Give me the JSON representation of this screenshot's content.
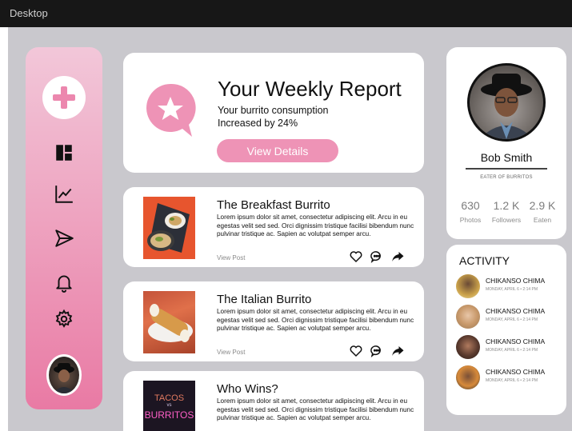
{
  "window": {
    "title": "Desktop"
  },
  "sidebar": {
    "items": [
      {
        "icon": "plus-icon"
      },
      {
        "icon": "dashboard-icon"
      },
      {
        "icon": "chart-icon"
      },
      {
        "icon": "send-icon"
      },
      {
        "icon": "bell-icon"
      },
      {
        "icon": "gear-icon"
      }
    ],
    "avatar": "user-avatar"
  },
  "report": {
    "title": "Your Weekly Report",
    "line1": "Your burrito consumption",
    "line2": "Increased by 24%",
    "button": "View Details"
  },
  "posts": [
    {
      "title": "The Breakfast Burrito",
      "body": "Lorem ipsum dolor sit amet, consectetur adipiscing elit. Arcu in eu egestas velit sed sed. Orci dignissim tristique facilisi bibendum nunc pulvinar tristique ac. Sapien ac volutpat semper arcu.",
      "link": "View Post"
    },
    {
      "title": "The Italian Burrito",
      "body": "Lorem ipsum dolor sit amet, consectetur adipiscing elit. Arcu in eu egestas velit sed sed. Orci dignissim tristique facilisi bibendum nunc pulvinar tristique ac. Sapien ac volutpat semper arcu.",
      "link": "View Post"
    },
    {
      "title": "Who Wins?",
      "body": "Lorem ipsum dolor sit amet, consectetur adipiscing elit. Arcu in eu egestas velit sed sed. Orci dignissim tristique facilisi bibendum nunc pulvinar tristique ac. Sapien ac volutpat semper arcu.",
      "thumb_text1": "TACOS",
      "thumb_text2": "vs",
      "thumb_text3": "BURRITOS"
    }
  ],
  "profile": {
    "name": "Bob Smith",
    "subtitle": "EATER OF BURRITOS",
    "stats": [
      {
        "value": "630",
        "label": "Photos"
      },
      {
        "value": "1.2 K",
        "label": "Followers"
      },
      {
        "value": "2.9 K",
        "label": "Eaten"
      }
    ]
  },
  "activity": {
    "title": "ACTIVITY",
    "items": [
      {
        "name": "CHIKANSO CHIMA",
        "time": "MONDAY, APRIL 6 • 2:14 PM"
      },
      {
        "name": "CHIKANSO CHIMA",
        "time": "MONDAY, APRIL 6 • 2:14 PM"
      },
      {
        "name": "CHIKANSO CHIMA",
        "time": "MONDAY, APRIL 6 • 2:14 PM"
      },
      {
        "name": "CHIKANSO CHIMA",
        "time": "MONDAY, APRIL 6 • 2:14 PM"
      }
    ]
  },
  "colors": {
    "accent": "#ee93b6",
    "sidebar_top": "#f2c7d9",
    "sidebar_bottom": "#e97aa4",
    "canvas": "#c9c8cd",
    "titlebar": "#171717"
  }
}
